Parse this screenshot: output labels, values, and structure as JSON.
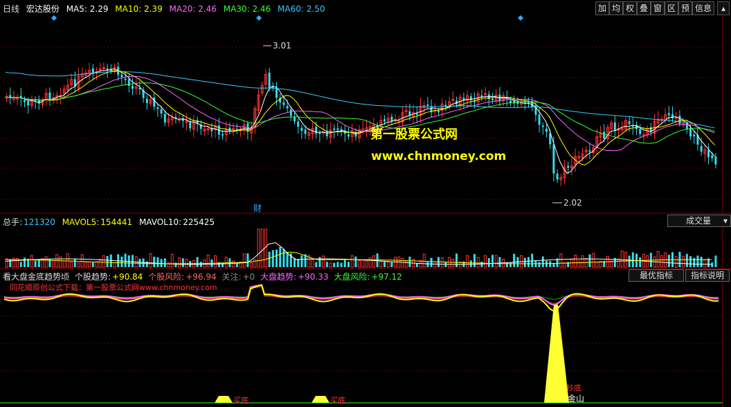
{
  "header": {
    "period": "日线",
    "stock_name": "宏达股份",
    "ma": [
      {
        "label": "MA5: 2.29",
        "color": "#ffffff"
      },
      {
        "label": "MA10: 2.39",
        "color": "#ffff00"
      },
      {
        "label": "MA20: 2.46",
        "color": "#ff66ff"
      },
      {
        "label": "MA30: 2.46",
        "color": "#33ff33"
      },
      {
        "label": "MA60: 2.50",
        "color": "#33ccff"
      }
    ],
    "toolbar": [
      "加",
      "均",
      "权",
      "叠",
      "窗",
      "区",
      "预",
      "信息"
    ]
  },
  "price_chart": {
    "high_label": "3.01",
    "low_label": "2.02",
    "finance_marker": "财"
  },
  "watermark": {
    "line1": "第一股票公式网",
    "line2": "www.chnmoney.com"
  },
  "volume_panel": {
    "total": {
      "label": "总手:",
      "value": "121320"
    },
    "mavol5": {
      "label": "MAVOL5:",
      "value": "154441"
    },
    "mavol10": {
      "label": "MAVOL10:",
      "value": "225425"
    },
    "select": "成交量"
  },
  "indicator_panel": {
    "title": "看大盘金底趋势顷",
    "items": [
      {
        "label": "个股趋势:",
        "value": "+90.84",
        "color": "#ffff00"
      },
      {
        "label": "个股风险:",
        "value": "+96.94",
        "color": "#ff6666"
      },
      {
        "label": "关注:",
        "value": "+0",
        "color": "#888888"
      },
      {
        "label": "大盘趋势:",
        "value": "+90.33",
        "color": "#ff66ff"
      },
      {
        "label": "大盘风险:",
        "value": "+97.12",
        "color": "#33ff33"
      }
    ],
    "sub_title": "同花顺原创公式下载：第一股票公式网www.chnmoney.com",
    "buttons": [
      "最优指标",
      "指标说明"
    ],
    "signals": [
      "买底",
      "买底",
      "抄底",
      "金山"
    ]
  },
  "colors": {
    "up": "#ff3333",
    "down": "#33ddee",
    "grid": "#8b0000"
  }
}
